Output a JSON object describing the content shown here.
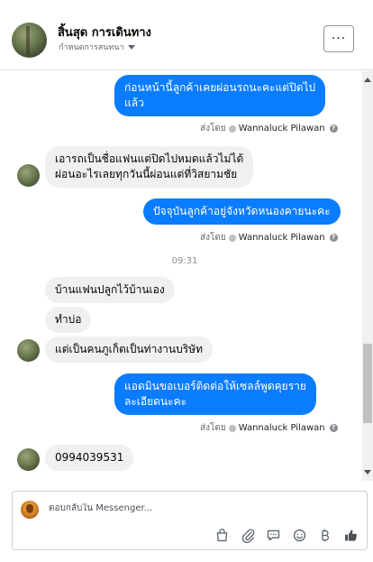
{
  "header": {
    "title": "สิ้นสุด การเดินทาง",
    "subtitle": "กำหนดการสนทนา",
    "more_label": "···"
  },
  "messages": [
    {
      "type": "out",
      "lines": [
        "ก่อนหน้านี้ลูกค้าเคยผ่อนรถนะคะแต่ปิดไป",
        "แล้ว"
      ]
    },
    {
      "type": "sent_by",
      "prefix": "ส่งโดย",
      "name": "Wannaluck Pilawan"
    },
    {
      "type": "in",
      "lines": [
        "เอารถเป็นชื่อแฟนแต่ปิดไปหมดแล้วไม่ได้",
        "ผ่อนอะไรเลยทุกวันนี้ผ่อนแต่ที่วิสยามชัย"
      ]
    },
    {
      "type": "out",
      "lines": [
        "ปัจจุบันลูกค้าอยู่จังหวัดหนองคายนะคะ"
      ]
    },
    {
      "type": "sent_by",
      "prefix": "ส่งโดย",
      "name": "Wannaluck Pilawan"
    },
    {
      "type": "time",
      "text": "09:31"
    },
    {
      "type": "in",
      "lines": [
        "บ้านแฟนปลูกไว้บ้านเอง"
      ]
    },
    {
      "type": "in",
      "lines": [
        "ทำบ่อ"
      ]
    },
    {
      "type": "in",
      "lines": [
        "แต่เป็นคนภูเก็ตเป็นท่างานบริษัท"
      ]
    },
    {
      "type": "out",
      "lines": [
        "แอดมินขอเบอร์ติดต่อให้เซลล์พูดคุยราย",
        "ละเอียดนะคะ"
      ]
    },
    {
      "type": "sent_by",
      "prefix": "ส่งโดย",
      "name": "Wannaluck Pilawan"
    },
    {
      "type": "in",
      "lines": [
        "0994039531"
      ]
    }
  ],
  "composer": {
    "placeholder": "ตอบกลับใน Messenger...",
    "tools": [
      "shopping-bag-icon",
      "paperclip-icon",
      "chat-bubble-icon",
      "emoji-icon",
      "baht-icon",
      "thumbs-up-icon"
    ]
  },
  "colors": {
    "outgoing_bubble": "#0a7cff",
    "incoming_bubble": "#f0f0f0",
    "accent": "#1877f2"
  }
}
